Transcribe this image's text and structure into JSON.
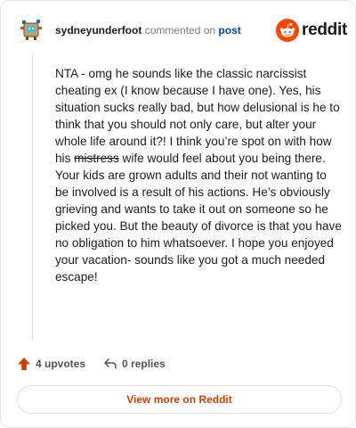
{
  "header": {
    "username": "sydneyunderfoot",
    "action_text": "commented on",
    "post_link_label": "post",
    "brand_name": "reddit"
  },
  "comment": {
    "text_before_strike": "NTA - omg he sounds like the classic narcissist cheating ex (I know because I have one). Yes, his situation sucks really bad, but how delusional is he to think that you should not only care, but alter your whole life around it?! I think you’re spot on with how his ",
    "struck_word": "mistress",
    "text_after_strike": " wife would feel about you being there. Your kids are grown adults and their not wanting to be involved is a result of his actions. He’s obviously grieving and wants to take it out on someone so he picked you. But the beauty of divorce is that you have no obligation to him whatsoever. I hope you enjoyed your vacation- sounds like you got a much needed escape!"
  },
  "actions": {
    "upvotes_label": "4 upvotes",
    "replies_label": "0 replies"
  },
  "footer": {
    "view_more_label": "View more on Reddit"
  },
  "colors": {
    "brand_orange": "#ff4500",
    "upvote_orange": "#d93a00",
    "link_blue": "#0045ac"
  },
  "icons": [
    "avatar-image",
    "reddit-snoo-icon",
    "upvote-arrow-icon",
    "reply-arrow-icon"
  ]
}
